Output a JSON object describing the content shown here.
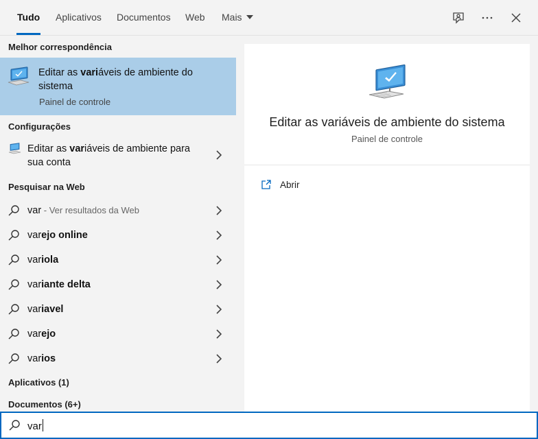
{
  "tabs": [
    {
      "label": "Tudo",
      "active": true
    },
    {
      "label": "Aplicativos"
    },
    {
      "label": "Documentos"
    },
    {
      "label": "Web"
    },
    {
      "label": "Mais"
    }
  ],
  "toolbar": {
    "feedback_icon": "feedback-icon",
    "more_icon": "more-options-icon",
    "close_icon": "close-icon"
  },
  "left": {
    "best_match_header": "Melhor correspondência",
    "best_match": {
      "title_pre": "Editar as ",
      "title_bold": "vari",
      "title_post": "áveis de ambiente do sistema",
      "subtitle": "Painel de controle"
    },
    "settings_header": "Configurações",
    "settings_item": {
      "title_pre": "Editar as ",
      "title_bold": "var",
      "title_post": "iáveis de ambiente para sua conta"
    },
    "web_header": "Pesquisar na Web",
    "web_first": {
      "query": "var",
      "hint": " - Ver resultados da Web"
    },
    "web_suggestions": [
      {
        "typed": "var",
        "rest": "ejo online"
      },
      {
        "typed": "var",
        "rest": "iola"
      },
      {
        "typed": "var",
        "rest": "iante delta"
      },
      {
        "typed": "var",
        "rest": "iavel"
      },
      {
        "typed": "var",
        "rest": "ejo"
      },
      {
        "typed": "var",
        "rest": "ios"
      }
    ],
    "apps_header": "Aplicativos (1)",
    "docs_header": "Documentos (6+)"
  },
  "detail": {
    "title": "Editar as variáveis de ambiente do sistema",
    "subtitle": "Painel de controle",
    "open_label": "Abrir"
  },
  "search": {
    "value": "var"
  },
  "colors": {
    "accent": "#0067c0",
    "selected_bg": "#aacde8",
    "panel_bg": "#f3f3f3"
  }
}
